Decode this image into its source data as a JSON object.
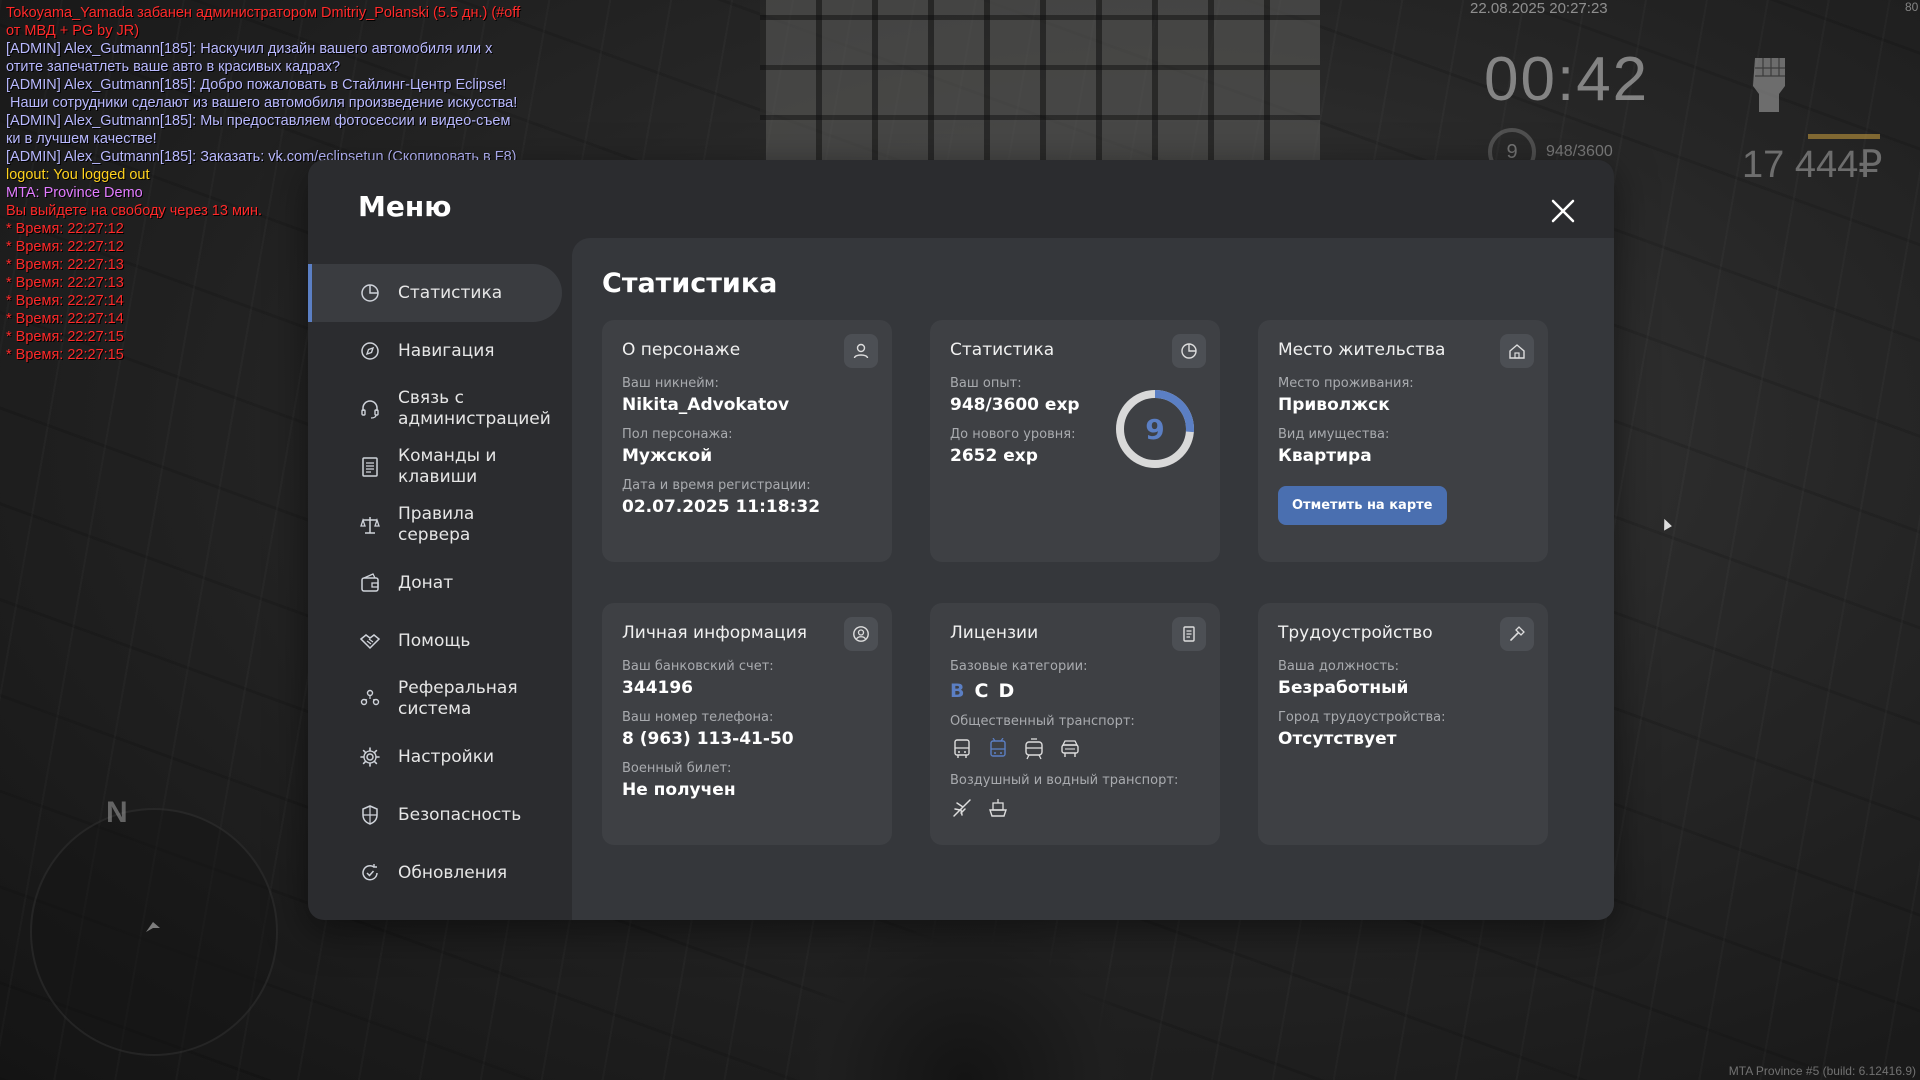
{
  "chat": [
    {
      "text": "Tokoyama_Yamada забанен администратором Dmitriy_Polanski (5.5 дн.) (#off",
      "color": "#ff2a2a"
    },
    {
      "text": "от МВД + PG by JR)",
      "color": "#ff2a2a"
    },
    {
      "text": "[ADMIN] Alex_Gutmann[185]: Наскучил дизайн вашего автомобиля или х",
      "color": "#b9b9ff"
    },
    {
      "text": "отите запечатлеть ваше авто в красивых кадрах?",
      "color": "#b9b9ff"
    },
    {
      "text": "[ADMIN] Alex_Gutmann[185]: Добро пожаловать в Стайлинг-Центр Eclipse!",
      "color": "#b9b9ff"
    },
    {
      "text": " Наши сотрудники сделают из вашего автомобиля произведение искусства!",
      "color": "#b9b9ff"
    },
    {
      "text": "[ADMIN] Alex_Gutmann[185]: Мы предоставляем фотосессии и видео-съем",
      "color": "#b9b9ff"
    },
    {
      "text": "ки в лучшем качестве!",
      "color": "#b9b9ff"
    },
    {
      "text": "[ADMIN] Alex_Gutmann[185]: Заказать: vk.com/eclipsetun (Скопировать в F8)",
      "color": "#b9b9ff"
    },
    {
      "text": "logout: You logged out",
      "color": "#ffd21e"
    },
    {
      "text": "MTA: Province Demo",
      "color": "#e27cff"
    },
    {
      "text": "Вы выйдете на свободу через 13 мин.",
      "color": "#ff2a2a"
    },
    {
      "text": "* Время: 22:27:12",
      "color": "#ff2a2a"
    },
    {
      "text": "* Время: 22:27:12",
      "color": "#ff2a2a"
    },
    {
      "text": "* Время: 22:27:13",
      "color": "#ff2a2a"
    },
    {
      "text": "* Время: 22:27:13",
      "color": "#ff2a2a"
    },
    {
      "text": "* Время: 22:27:14",
      "color": "#ff2a2a"
    },
    {
      "text": "* Время: 22:27:14",
      "color": "#ff2a2a"
    },
    {
      "text": "* Время: 22:27:15",
      "color": "#ff2a2a"
    },
    {
      "text": "* Время: 22:27:15",
      "color": "#ff2a2a"
    }
  ],
  "hud": {
    "date": "22.08.2025 20:27:23",
    "corner": "80",
    "timer": "00:42",
    "level": "9",
    "exp": "948/3600",
    "money": "17 444₽",
    "build": "MTA Province #5 (build: 6.12416.9)",
    "radar_north": "N"
  },
  "menu": {
    "title": "Меню",
    "close_icon": "close-icon",
    "nav": [
      {
        "label": "Статистика",
        "icon": "chart-pie-icon",
        "active": true
      },
      {
        "label": "Навигация",
        "icon": "compass-icon",
        "active": false
      },
      {
        "label": "Связь с администрацией",
        "icon": "headset-icon",
        "active": false
      },
      {
        "label": "Команды и клавиши",
        "icon": "document-icon",
        "active": false
      },
      {
        "label": "Правила сервера",
        "icon": "scales-icon",
        "active": false
      },
      {
        "label": "Донат",
        "icon": "wallet-icon",
        "active": false
      },
      {
        "label": "Помощь",
        "icon": "handshake-icon",
        "active": false
      },
      {
        "label": "Реферальная система",
        "icon": "people-icon",
        "active": false
      },
      {
        "label": "Настройки",
        "icon": "gear-icon",
        "active": false
      },
      {
        "label": "Безопасность",
        "icon": "shield-icon",
        "active": false
      },
      {
        "label": "Обновления",
        "icon": "refresh-check-icon",
        "active": false
      }
    ]
  },
  "stats": {
    "title": "Статистика",
    "character": {
      "title": "О персонаже",
      "nickname_label": "Ваш никнейм:",
      "nickname": "Nikita_Advokatov",
      "gender_label": "Пол персонажа:",
      "gender": "Мужской",
      "reg_label": "Дата и время регистрации:",
      "reg": "02.07.2025 11:18:32"
    },
    "statistics": {
      "title": "Статистика",
      "exp_label": "Ваш опыт:",
      "exp": "948/3600 exp",
      "next_label": "До нового уровня:",
      "next": "2652 exp",
      "level": "9",
      "progress": 0.263
    },
    "residence": {
      "title": "Место жительства",
      "place_label": "Место проживания:",
      "place": "Приволжск",
      "type_label": "Вид имущества:",
      "type": "Квартира",
      "button": "Отметить на карте"
    },
    "personal": {
      "title": "Личная информация",
      "bank_label": "Ваш банковский счет:",
      "bank": "344196",
      "phone_label": "Ваш номер телефона:",
      "phone": "8 (963) 113-41-50",
      "military_label": "Военный билет:",
      "military": "Не получен"
    },
    "licenses": {
      "title": "Лицензии",
      "base_label": "Базовые категории:",
      "categories": [
        "B",
        "C",
        "D"
      ],
      "public_label": "Общественный транспорт:",
      "air_label": "Воздушный и водный транспорт:"
    },
    "employment": {
      "title": "Трудоустройство",
      "position_label": "Ваша должность:",
      "position": "Безработный",
      "city_label": "Город трудоустройства:",
      "city": "Отсутствует"
    }
  },
  "colors": {
    "accent": "#5b7fc4",
    "panel": "#2b2c2f",
    "card": "#3e4044"
  }
}
